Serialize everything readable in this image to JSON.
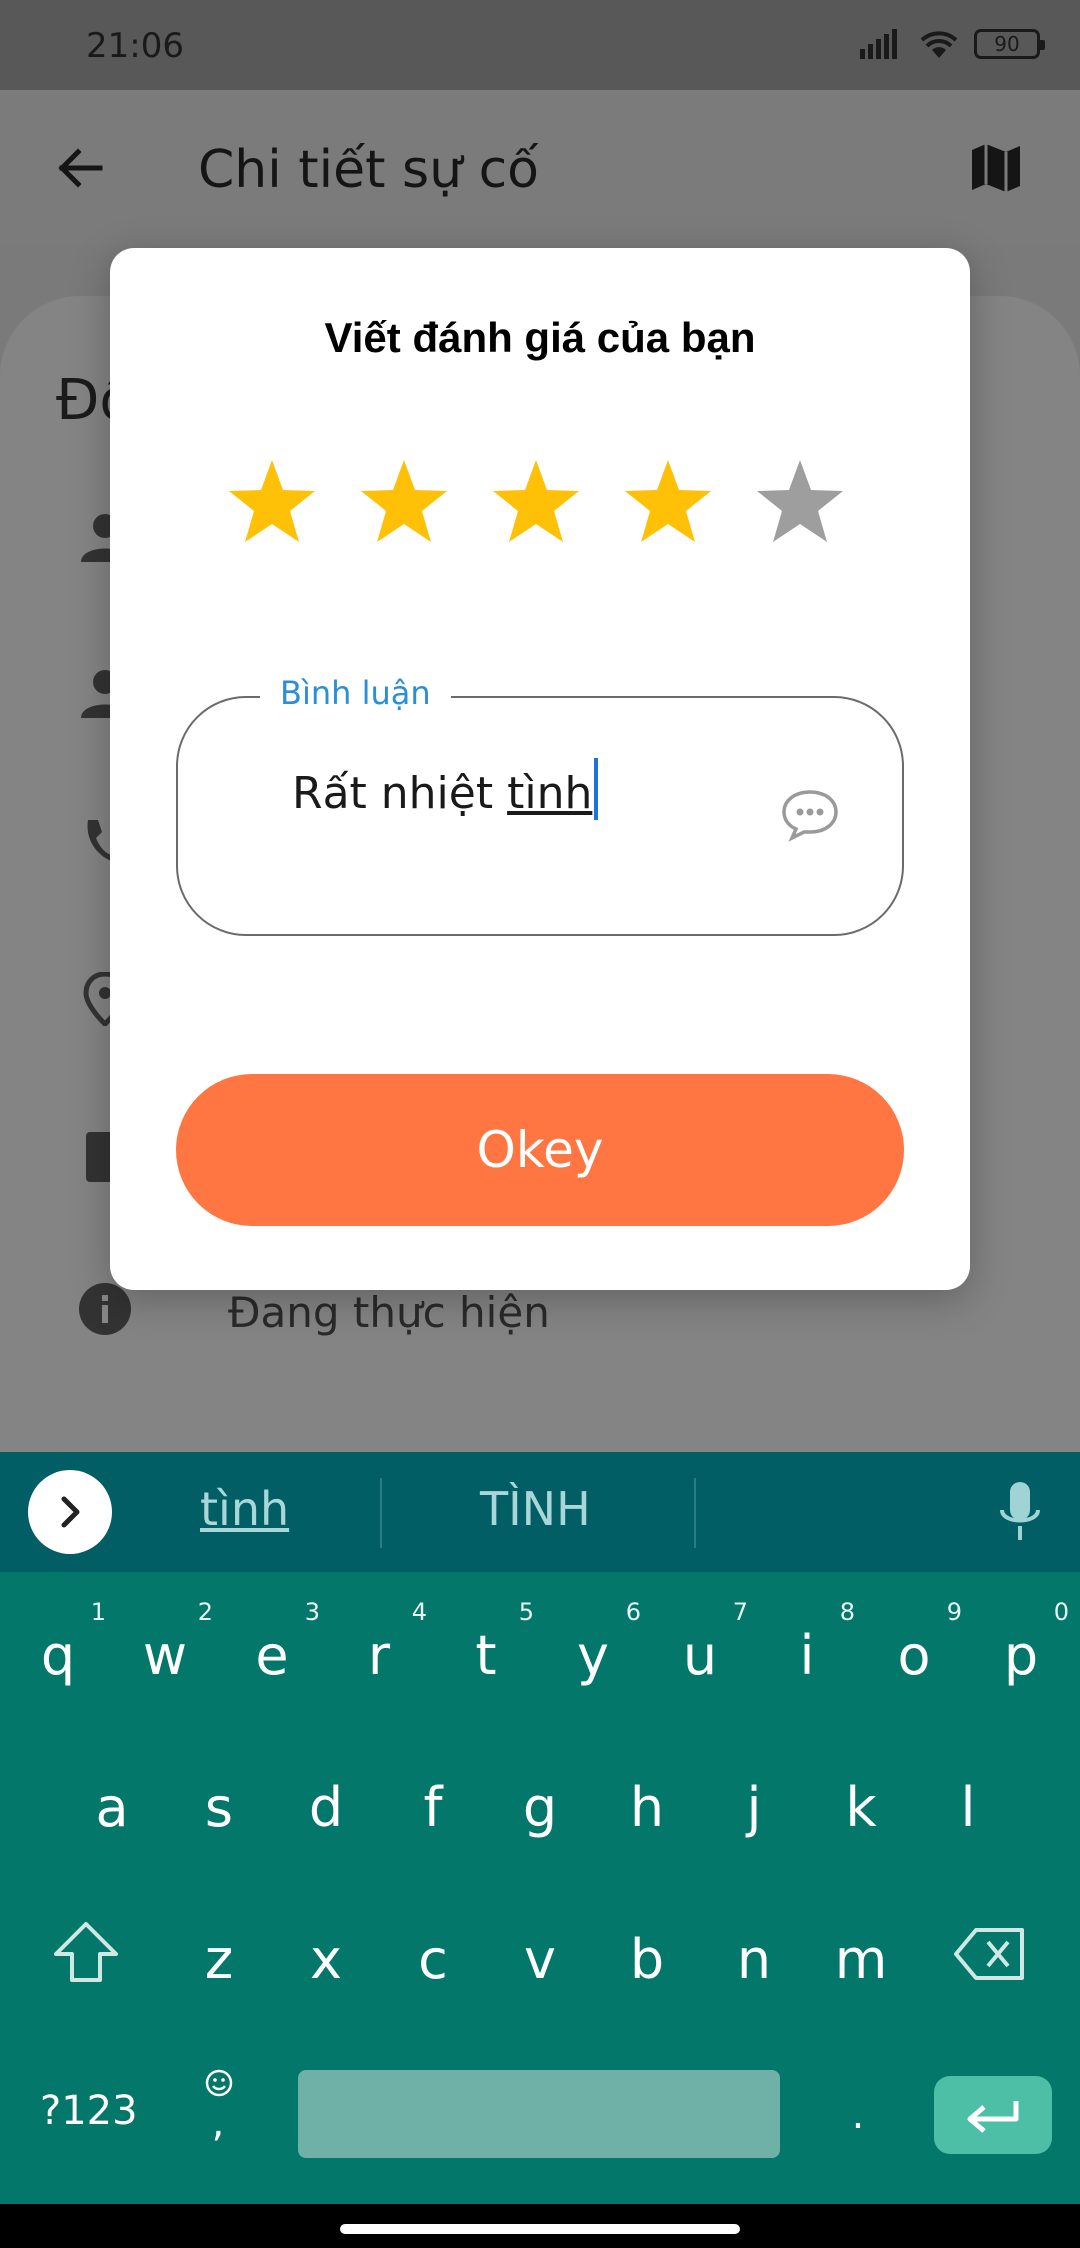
{
  "status_bar": {
    "time": "21:06",
    "battery": "90"
  },
  "app_bar": {
    "title": "Chi tiết sự cố"
  },
  "background": {
    "heading_partial": "Đô",
    "status_text": "Đang thực hiện"
  },
  "dialog": {
    "title": "Viết đánh giá của bạn",
    "rating": {
      "value": 4,
      "max": 5,
      "filled_color": "#ffc107",
      "empty_color": "#9e9e9e"
    },
    "comment": {
      "label": "Bình luận",
      "text_prefix": "Rất nhiệt ",
      "text_current_word": "tình"
    },
    "ok_button": "Okey",
    "accent_color": "#ff7643"
  },
  "keyboard": {
    "suggestions": [
      "tình",
      "TÌNH"
    ],
    "row1": [
      {
        "k": "q",
        "n": "1"
      },
      {
        "k": "w",
        "n": "2"
      },
      {
        "k": "e",
        "n": "3"
      },
      {
        "k": "r",
        "n": "4"
      },
      {
        "k": "t",
        "n": "5"
      },
      {
        "k": "y",
        "n": "6"
      },
      {
        "k": "u",
        "n": "7"
      },
      {
        "k": "i",
        "n": "8"
      },
      {
        "k": "o",
        "n": "9"
      },
      {
        "k": "p",
        "n": "0"
      }
    ],
    "row2": [
      "a",
      "s",
      "d",
      "f",
      "g",
      "h",
      "j",
      "k",
      "l"
    ],
    "row3": [
      "z",
      "x",
      "c",
      "v",
      "b",
      "n",
      "m"
    ],
    "symbols_key": "?123",
    "comma_key": ",",
    "period_key": "."
  }
}
